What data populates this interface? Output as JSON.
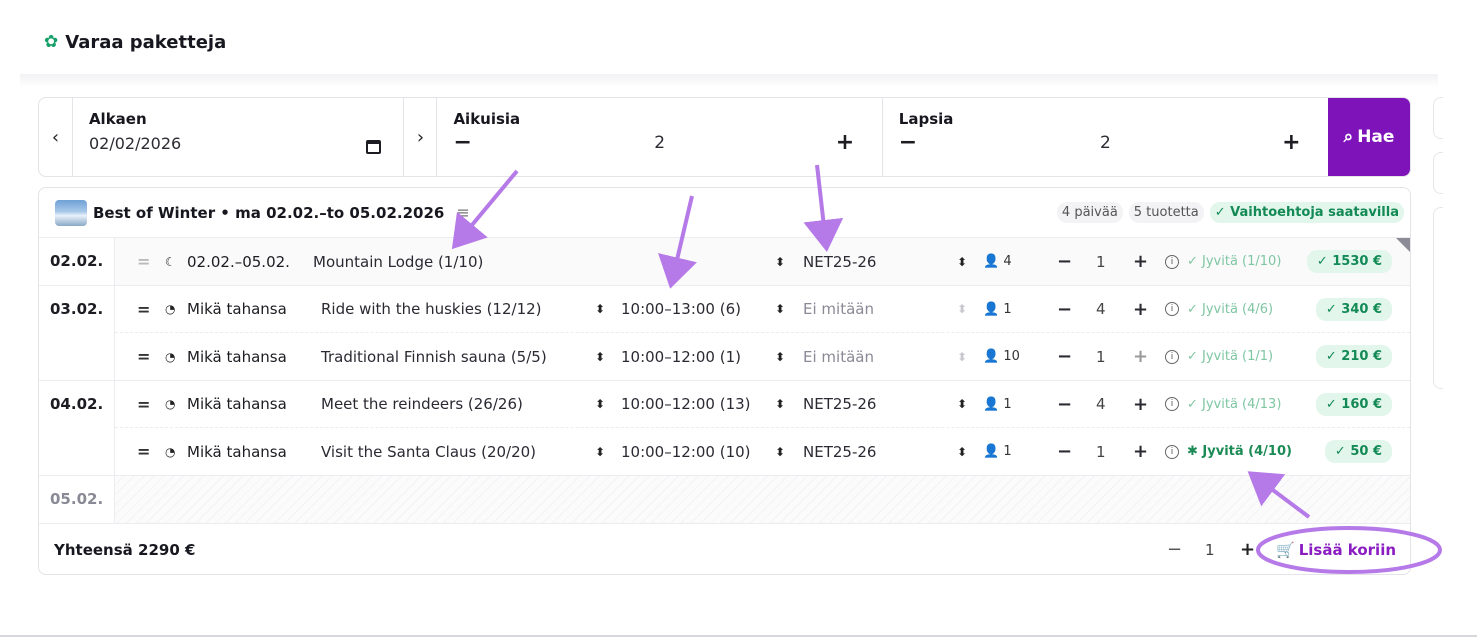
{
  "header": {
    "title": "Varaa paketteja",
    "logo_icon": "puzzle-icon"
  },
  "search": {
    "date_label": "Alkaen",
    "date_value": "02/02/2026",
    "adults_label": "Aikuisia",
    "adults_value": "2",
    "children_label": "Lapsia",
    "children_value": "2",
    "minus": "−",
    "plus": "+",
    "prev": "‹",
    "next": "›",
    "search_label": "Hae"
  },
  "package": {
    "title": "Best of Winter • ma 02.02.–to 05.02.2026",
    "days_badge": "4 päivää",
    "products_badge": "5 tuotetta",
    "availability_badge": "✓ Vaihtoehtoja saatavilla"
  },
  "days": [
    {
      "date": "02.02.",
      "items": [
        {
          "type": "☾",
          "type_text": "02.02.–05.02.",
          "name": "Mountain Lodge (1/10)",
          "time": "",
          "rate": "NET25-26",
          "guests": "4",
          "qty": "1",
          "reserve": "✓ Jyvitä (1/10)",
          "price": "✓ 1530 €"
        }
      ]
    },
    {
      "date": "03.02.",
      "items": [
        {
          "type": "◔",
          "type_text": "Mikä tahansa",
          "name": "Ride with the huskies (12/12)",
          "time": "10:00–13:00 (6)",
          "rate": "Ei mitään",
          "guests": "1",
          "qty": "4",
          "reserve": "✓ Jyvitä (4/6)",
          "price": "✓ 340 €"
        },
        {
          "type": "◔",
          "type_text": "Mikä tahansa",
          "name": "Traditional Finnish sauna (5/5)",
          "time": "10:00–12:00 (1)",
          "rate": "Ei mitään",
          "guests": "10",
          "qty": "1",
          "reserve": "✓ Jyvitä (1/1)",
          "price": "✓ 210 €"
        }
      ]
    },
    {
      "date": "04.02.",
      "items": [
        {
          "type": "◔",
          "type_text": "Mikä tahansa",
          "name": "Meet the reindeers (26/26)",
          "time": "10:00–12:00 (13)",
          "rate": "NET25-26",
          "guests": "1",
          "qty": "4",
          "reserve": "✓ Jyvitä (4/13)",
          "price": "✓ 160 €"
        },
        {
          "type": "◔",
          "type_text": "Mikä tahansa",
          "name": "Visit the Santa Claus (20/20)",
          "time": "10:00–12:00 (10)",
          "rate": "NET25-26",
          "guests": "1",
          "qty": "1",
          "reserve": "✱ Jyvitä (4/10)",
          "price": "✓ 50 €"
        }
      ]
    },
    {
      "date": "05.02.",
      "items": []
    }
  ],
  "footer": {
    "total": "Yhteensä 2290 €",
    "cart_qty": "1",
    "add_to_cart": "Lisää koriin"
  }
}
